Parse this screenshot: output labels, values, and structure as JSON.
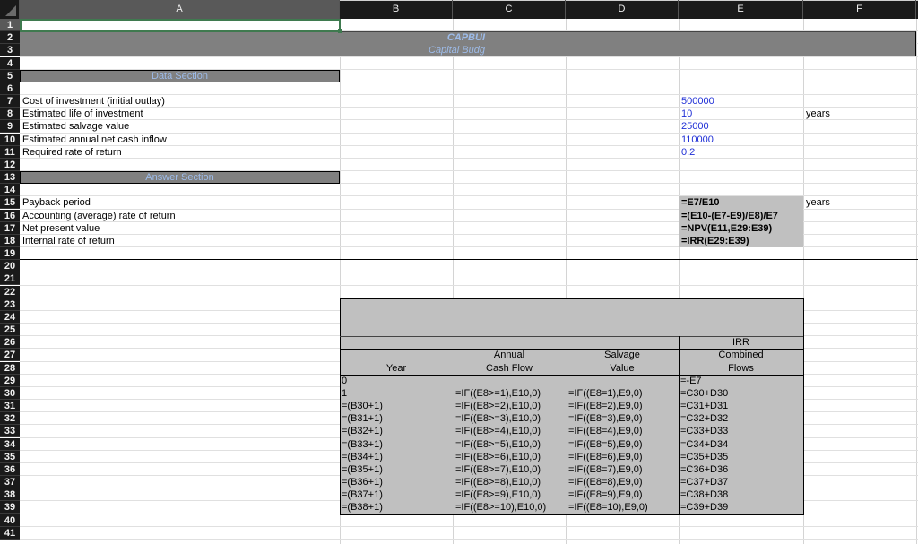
{
  "spreadsheet": {
    "columns": [
      "A",
      "B",
      "C",
      "D",
      "E",
      "F"
    ],
    "rows": [
      "1",
      "2",
      "3",
      "4",
      "5",
      "6",
      "7",
      "8",
      "9",
      "10",
      "11",
      "12",
      "13",
      "14",
      "15",
      "16",
      "17",
      "18",
      "19",
      "20",
      "21",
      "22",
      "23",
      "24",
      "25",
      "26",
      "27",
      "28",
      "29",
      "30",
      "31",
      "32",
      "33",
      "34",
      "35",
      "36",
      "37",
      "38",
      "39",
      "40",
      "41"
    ],
    "selected_cell": "A1",
    "title": {
      "main": "CAPBUI",
      "sub": "Capital Budg"
    },
    "sections": {
      "data": "Data Section",
      "answer": "Answer Section"
    },
    "data_section": [
      {
        "row": "7",
        "label": "Cost of investment (initial outlay)",
        "value": "500000",
        "unit": ""
      },
      {
        "row": "8",
        "label": "Estimated life of investment",
        "value": "10",
        "unit": "years"
      },
      {
        "row": "9",
        "label": "Estimated salvage value",
        "value": "25000",
        "unit": ""
      },
      {
        "row": "10",
        "label": "Estimated annual net cash inflow",
        "value": "110000",
        "unit": ""
      },
      {
        "row": "11",
        "label": "Required rate of return",
        "value": "0.2",
        "unit": ""
      }
    ],
    "answer_section": [
      {
        "row": "15",
        "label": "Payback period",
        "formula": "=E7/E10",
        "unit": "years"
      },
      {
        "row": "16",
        "label": "Accounting (average) rate of return",
        "formula": "=(E10-(E7-E9)/E8)/E7",
        "unit": ""
      },
      {
        "row": "17",
        "label": "Net present value",
        "formula": "=NPV(E11,E29:E39)",
        "unit": ""
      },
      {
        "row": "18",
        "label": "Internal rate of return",
        "formula": "=IRR(E29:E39)",
        "unit": ""
      }
    ],
    "cash_flow_table": {
      "header_irr": "IRR",
      "headers": {
        "year": "Year",
        "annual_line1": "Annual",
        "annual_line2": "Cash Flow",
        "salvage_line1": "Salvage",
        "salvage_line2": "Value",
        "combined_line1": "Combined",
        "combined_line2": "Flows"
      },
      "rows": [
        {
          "year": "0",
          "annual": "",
          "salvage": "",
          "combined": "=-E7"
        },
        {
          "year": "1",
          "annual": "=IF((E8>=1),E10,0)",
          "salvage": "=IF((E8=1),E9,0)",
          "combined": "=C30+D30"
        },
        {
          "year": "=(B30+1)",
          "annual": "=IF((E8>=2),E10,0)",
          "salvage": "=IF((E8=2),E9,0)",
          "combined": "=C31+D31"
        },
        {
          "year": "=(B31+1)",
          "annual": "=IF((E8>=3),E10,0)",
          "salvage": "=IF((E8=3),E9,0)",
          "combined": "=C32+D32"
        },
        {
          "year": "=(B32+1)",
          "annual": "=IF((E8>=4),E10,0)",
          "salvage": "=IF((E8=4),E9,0)",
          "combined": "=C33+D33"
        },
        {
          "year": "=(B33+1)",
          "annual": "=IF((E8>=5),E10,0)",
          "salvage": "=IF((E8=5),E9,0)",
          "combined": "=C34+D34"
        },
        {
          "year": "=(B34+1)",
          "annual": "=IF((E8>=6),E10,0)",
          "salvage": "=IF((E8=6),E9,0)",
          "combined": "=C35+D35"
        },
        {
          "year": "=(B35+1)",
          "annual": "=IF((E8>=7),E10,0)",
          "salvage": "=IF((E8=7),E9,0)",
          "combined": "=C36+D36"
        },
        {
          "year": "=(B36+1)",
          "annual": "=IF((E8>=8),E10,0)",
          "salvage": "=IF((E8=8),E9,0)",
          "combined": "=C37+D37"
        },
        {
          "year": "=(B37+1)",
          "annual": "=IF((E8>=9),E10,0)",
          "salvage": "=IF((E8=9),E9,0)",
          "combined": "=C38+D38"
        },
        {
          "year": "=(B38+1)",
          "annual": "=IF((E8>=10),E10,0)",
          "salvage": "=IF((E8=10),E9,0)",
          "combined": "=C39+D39"
        }
      ]
    },
    "colors": {
      "input_value": "#1f2fd6",
      "section_label": "#9dbbe8",
      "band": "#808080",
      "formula_fill": "#c0c0c0",
      "selection": "#3f7a4f"
    }
  }
}
